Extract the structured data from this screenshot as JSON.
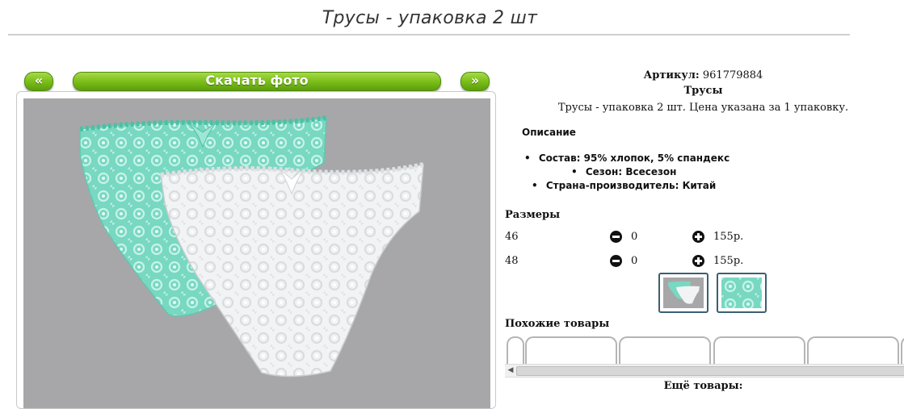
{
  "page": {
    "title": "Трусы - упаковка 2 шт"
  },
  "gallery": {
    "prev_label": "«",
    "download_label": "Скачать фото",
    "next_label": "»"
  },
  "product": {
    "sku_label": "Артикул:",
    "sku_value": "961779884",
    "name": "Трусы",
    "description": "Трусы - упаковка 2 шт. Цена указана за 1 упаковку.",
    "desc_heading": "Описание",
    "specs": [
      {
        "label": "Состав:",
        "value": "95% хлопок, 5% спандекс"
      },
      {
        "label": "Сезон:",
        "value": "Всесезон"
      },
      {
        "label": "Страна-производитель:",
        "value": "Китай"
      }
    ]
  },
  "sizes": {
    "heading": "Размеры",
    "rows": [
      {
        "size": "46",
        "qty": "0",
        "price": "155р."
      },
      {
        "size": "48",
        "qty": "0",
        "price": "155р."
      }
    ]
  },
  "similar": {
    "heading": "Похожие товары"
  },
  "more": {
    "label": "Ещё товары:"
  },
  "colors": {
    "accent_green": "#7fc21c",
    "photo_bg": "#a7a7a9",
    "mint": "#79d9c3"
  },
  "icons": [
    "minus-circle-icon",
    "plus-circle-icon",
    "scroll-left-arrow-icon"
  ]
}
